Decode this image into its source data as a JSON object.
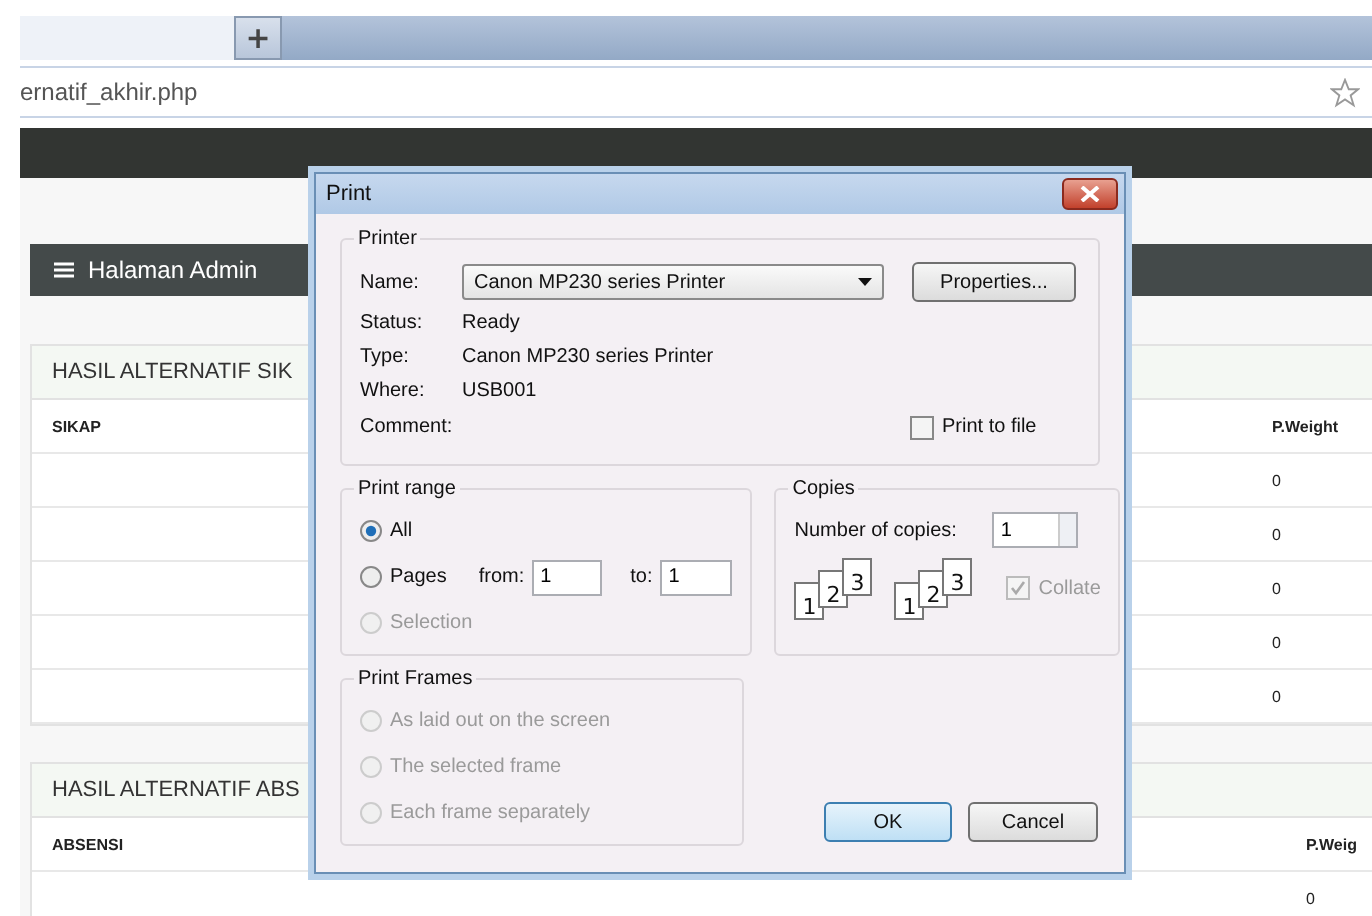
{
  "browser": {
    "new_tab_button": "+",
    "address": "ernatif_akhir.php"
  },
  "admin_header": {
    "title": "Halaman Admin"
  },
  "cards": [
    {
      "title": "HASIL ALTERNATIF SIK",
      "columns": [
        "SIKAP",
        "P.Weight"
      ],
      "rows": [
        "0",
        "0",
        "0",
        "0",
        "0"
      ]
    },
    {
      "title": "HASIL ALTERNATIF ABS",
      "columns": [
        "ABSENSI",
        "P.Weig"
      ],
      "rows": [
        "0"
      ]
    }
  ],
  "dialog": {
    "title": "Print",
    "printer": {
      "legend": "Printer",
      "name_label": "Name:",
      "name_value": "Canon MP230 series Printer",
      "properties_button": "Properties...",
      "info": [
        {
          "label": "Status:",
          "value": "Ready"
        },
        {
          "label": "Type:",
          "value": "Canon MP230 series Printer"
        },
        {
          "label": "Where:",
          "value": "USB001"
        },
        {
          "label": "Comment:"
        }
      ],
      "print_to_file": {
        "label": "Print to file",
        "checked": false
      }
    },
    "print_range": {
      "legend": "Print range",
      "options": [
        {
          "label": "All",
          "selected": true,
          "disabled": false
        },
        {
          "label": "Pages",
          "selected": false,
          "disabled": false
        },
        {
          "label": "Selection",
          "selected": false,
          "disabled": true
        }
      ],
      "from_label": "from:",
      "from_value": "1",
      "to_label": "to:",
      "to_value": "1"
    },
    "copies": {
      "legend": "Copies",
      "number_label": "Number of copies:",
      "number_value": "1",
      "collate_stacks": [
        [
          "1",
          "2",
          "3"
        ],
        [
          "1",
          "2",
          "3"
        ]
      ],
      "collate": {
        "label": "Collate",
        "checked": true,
        "disabled": true
      }
    },
    "print_frames": {
      "legend": "Print Frames",
      "options": [
        {
          "label": "As laid out on the screen",
          "selected": false,
          "disabled": true
        },
        {
          "label": "The selected frame",
          "selected": false,
          "disabled": true
        },
        {
          "label": "Each frame separately",
          "selected": false,
          "disabled": true
        }
      ]
    },
    "buttons": [
      {
        "label": "OK",
        "default": true
      },
      {
        "label": "Cancel",
        "default": false
      }
    ]
  }
}
